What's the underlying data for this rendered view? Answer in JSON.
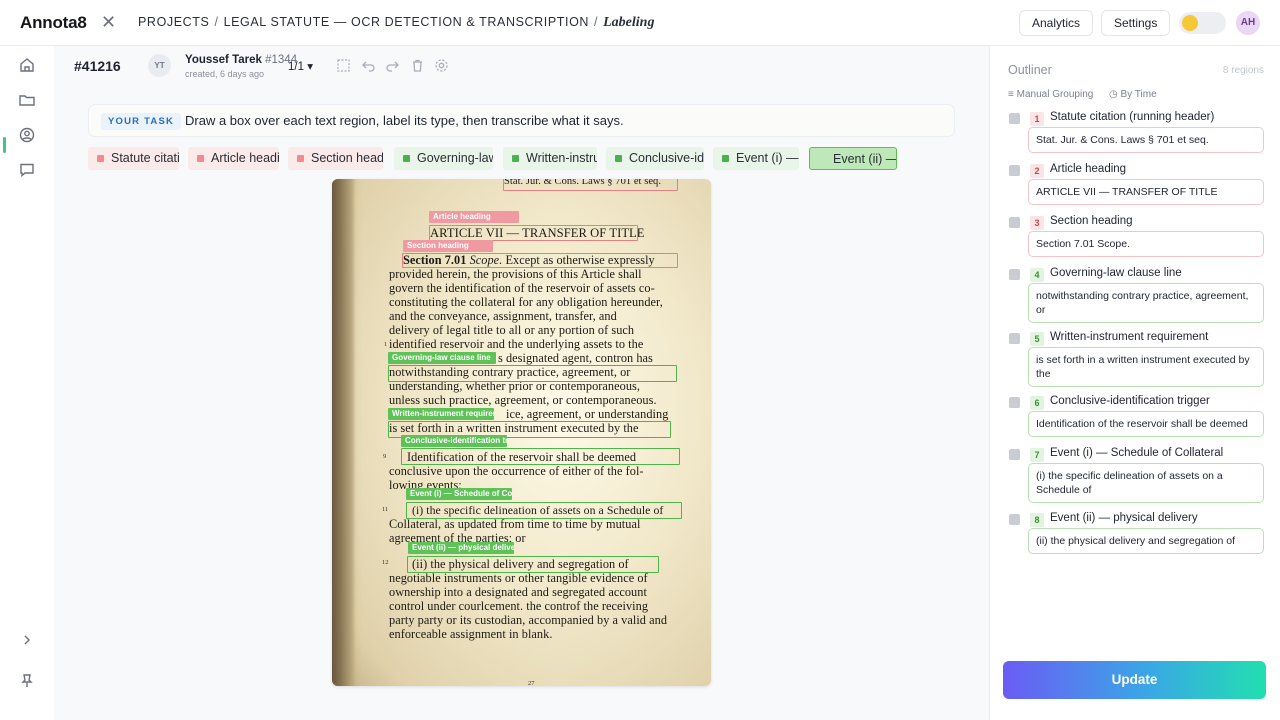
{
  "header": {
    "logo": "Annota8",
    "breadcrumb": {
      "projects": "PROJECTS",
      "project": "LEGAL STATUTE — OCR DETECTION & TRANSCRIPTION",
      "current": "Labeling",
      "sep": "/"
    },
    "analytics_label": "Analytics",
    "settings_label": "Settings",
    "user_initials": "AH"
  },
  "task": {
    "id": "#41216",
    "annotator_initials": "YT",
    "annotator_name": "Youssef Tarek",
    "annotator_id": "#1344",
    "created": "created, 6 days ago",
    "pager": "1/1",
    "badge": "YOUR TASK",
    "instruction": "Draw a box over each text region, label its type, then transcribe what it says."
  },
  "labels": [
    {
      "text": "Statute citation (running header)",
      "color": "#ef8c92"
    },
    {
      "text": "Article heading",
      "color": "#ef8c92"
    },
    {
      "text": "Section heading",
      "color": "#ef8c92"
    },
    {
      "text": "Governing-law clause line",
      "color": "#4caf50"
    },
    {
      "text": "Written-instrument requirement",
      "color": "#4caf50"
    },
    {
      "text": "Conclusive-identification trigger",
      "color": "#4caf50"
    },
    {
      "text": "Event (i) — Schedule of Collateral",
      "color": "#4caf50"
    },
    {
      "text": "Event (ii) — physical delivery",
      "color": "#4caf50",
      "selected": true
    }
  ],
  "document": {
    "header": "Stat. Jur. & Cons. Laws § 701 et seq.",
    "article": "ARTICLE VII — TRANSFER OF TITLE",
    "section_lead": "Section 7.01",
    "section_scope": "Scope.",
    "lines": [
      "Except as otherwise expressly",
      "provided herein, the provisions of this Article shall",
      "govern the identification of the reservoir of assets co-",
      "constituting the collateral for any obligation hereunder,",
      "and the conveyance, assignment, transfer, and",
      "delivery of legal title to all or any portion of such",
      "identified reservoir and the underlying assets to the",
      "s designated agent,     contron has",
      "notwithstanding contrary practice, agreement, or",
      "understanding, whether prior or contemporaneous,",
      "unless such practice, agreement, or contemporaneous.",
      "ice, agreement, or understanding",
      "is set forth in a written instrument executed by the",
      "Identification of the reservoir shall be deemed",
      "conclusive upon the occurrence of either of the fol-",
      "lowing events:",
      "(i) the specific delineation of assets on a Schedule of",
      "Collateral, as updated from time to time by mutual",
      "agreement of the parties; or",
      "(ii) the physical delivery and segregation of",
      "negotiable instruments or other tangible evidence of",
      "ownership into a designated and segregated account",
      "control under courlcement. the controf the receiving",
      "party party or its custodian, accompanied by a valid and",
      "enforceable assignment in blank."
    ],
    "margin_numbers": [
      "1",
      "9",
      "11",
      "12"
    ],
    "page_number": "27"
  },
  "outliner": {
    "title": "Outliner",
    "count": "8 regions",
    "group_label": "Manual Grouping",
    "time_label": "By Time",
    "items": [
      {
        "n": "1",
        "name": "Statute citation (running header)",
        "text": "Stat. Jur. & Cons. Laws § 701 et seq."
      },
      {
        "n": "2",
        "name": "Article heading",
        "text": "ARTICLE VII — TRANSFER OF TITLE"
      },
      {
        "n": "3",
        "name": "Section heading",
        "text": "Section 7.01 Scope."
      },
      {
        "n": "4",
        "name": "Governing-law clause line",
        "text": "notwithstanding contrary practice, agreement, or"
      },
      {
        "n": "5",
        "name": "Written-instrument requirement",
        "text": "is set forth in a written instrument executed by the"
      },
      {
        "n": "6",
        "name": "Conclusive-identification trigger",
        "text": "Identification of the reservoir shall be deemed"
      },
      {
        "n": "7",
        "name": "Event (i) — Schedule of Collateral",
        "text": "(i) the specific delineation of assets on a Schedule of"
      },
      {
        "n": "8",
        "name": "Event (ii) — physical delivery",
        "text": "(ii) the physical delivery and segregation of"
      }
    ]
  },
  "actions": {
    "update_label": "Update"
  },
  "colors": {
    "accent_green": "#4caf50",
    "accent_red": "#ef8c92",
    "toggle_knob": "#f6c736"
  }
}
